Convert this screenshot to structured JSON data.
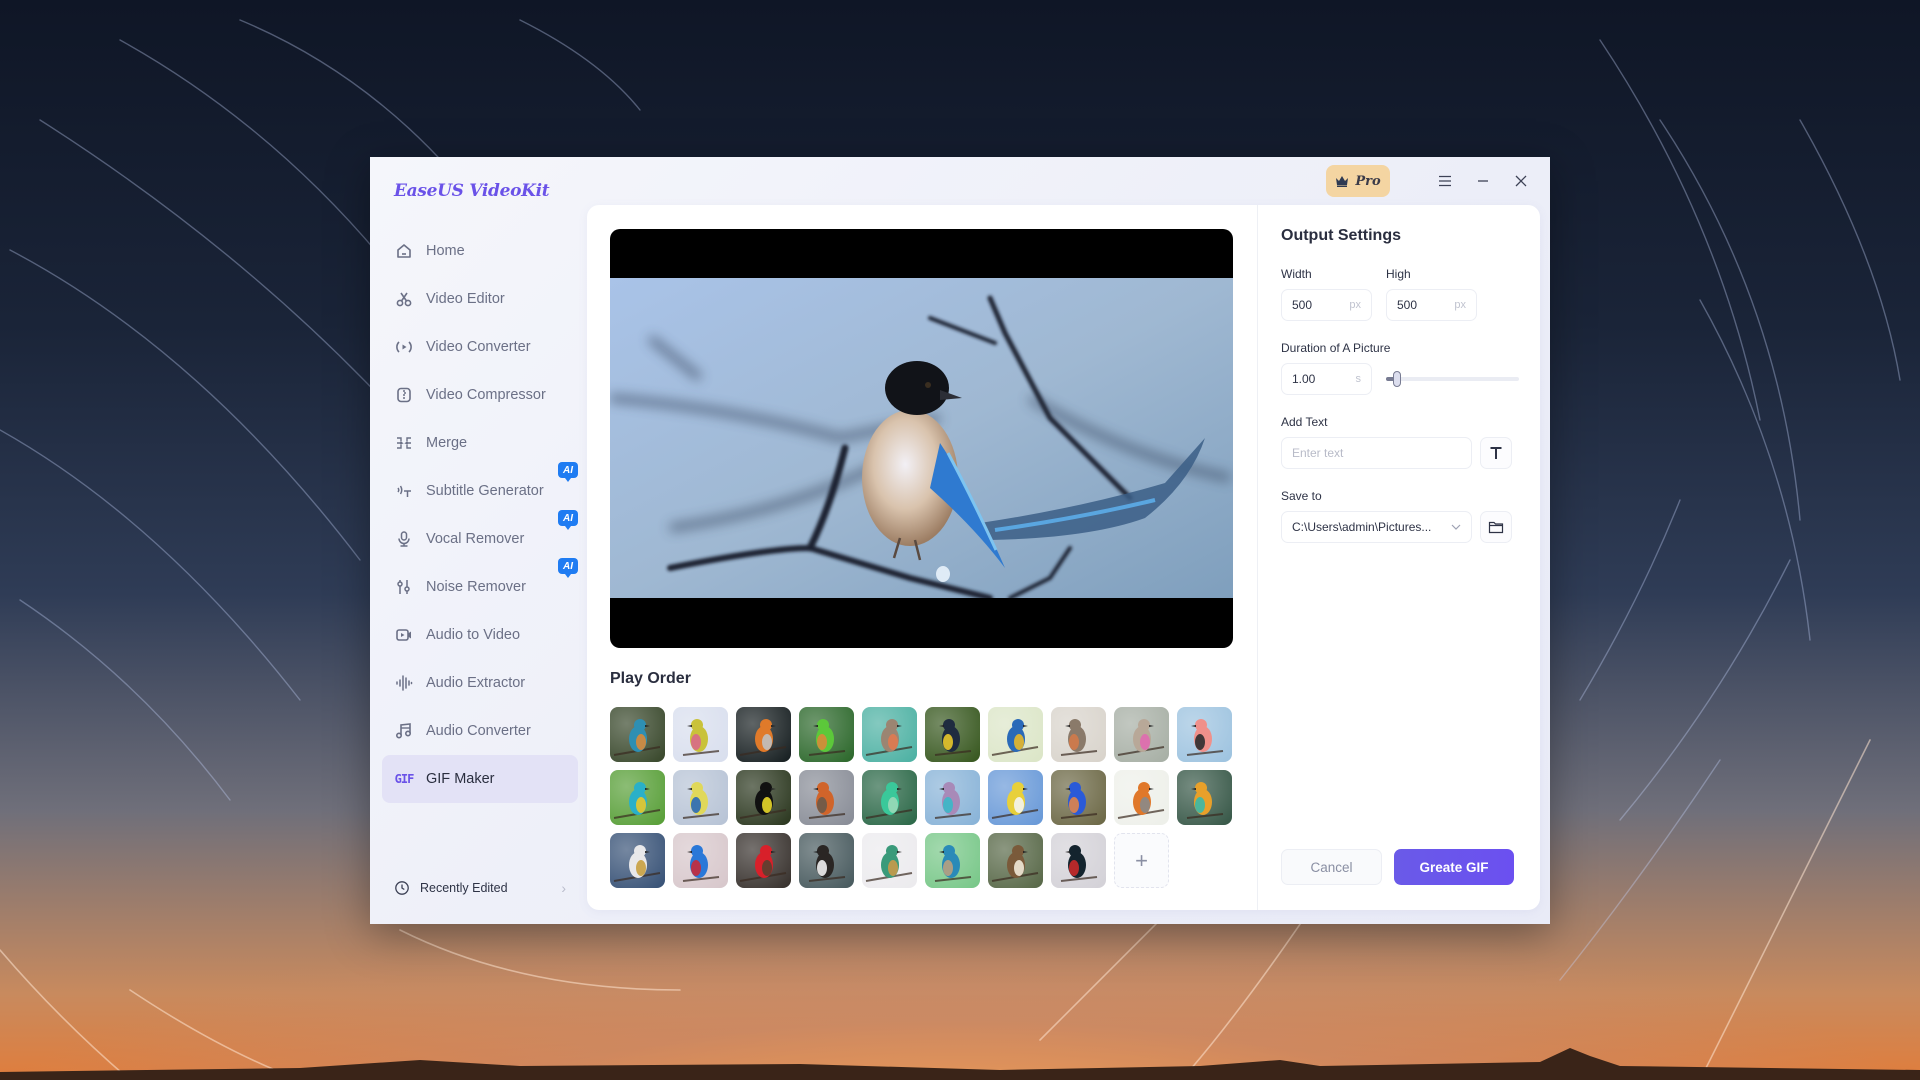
{
  "app": {
    "title": "EaseUS VideoKit",
    "brand_color": "#6a52e8",
    "pro_label": "Pro"
  },
  "window_controls": {
    "menu": "menu-icon",
    "minimize": "minimize-icon",
    "close": "close-icon"
  },
  "sidebar": {
    "items": [
      {
        "label": "Home",
        "icon": "home-icon",
        "ai": false,
        "active": false
      },
      {
        "label": "Video Editor",
        "icon": "scissors-icon",
        "ai": false,
        "active": false
      },
      {
        "label": "Video Converter",
        "icon": "convert-icon",
        "ai": false,
        "active": false
      },
      {
        "label": "Video Compressor",
        "icon": "compress-icon",
        "ai": false,
        "active": false
      },
      {
        "label": "Merge",
        "icon": "merge-icon",
        "ai": false,
        "active": false
      },
      {
        "label": "Subtitle Generator",
        "icon": "subtitle-icon",
        "ai": true,
        "active": false
      },
      {
        "label": "Vocal Remover",
        "icon": "microphone-icon",
        "ai": true,
        "active": false
      },
      {
        "label": "Noise Remover",
        "icon": "equalizer-icon",
        "ai": true,
        "active": false
      },
      {
        "label": "Audio to Video",
        "icon": "video-camera-icon",
        "ai": false,
        "active": false
      },
      {
        "label": "Audio Extractor",
        "icon": "waveform-icon",
        "ai": false,
        "active": false
      },
      {
        "label": "Audio Converter",
        "icon": "music-note-icon",
        "ai": false,
        "active": false
      },
      {
        "label": "GIF Maker",
        "icon": "gif-icon",
        "ai": false,
        "active": true
      }
    ],
    "ai_badge": "AI",
    "gif_glyph": "GIF",
    "recently_edited": "Recently Edited"
  },
  "preview": {
    "subject": "Azure-winged magpie perched on a branch"
  },
  "play_order": {
    "title": "Play Order",
    "add_label": "+",
    "images": [
      {
        "name": "kingfisher",
        "bg": "#3b4a2e",
        "c1": "#2e8fb3",
        "c2": "#d88a3a"
      },
      {
        "name": "white-eye",
        "bg": "#d9dfee",
        "c1": "#c9c23a",
        "c2": "#d86a8a"
      },
      {
        "name": "sun-conure",
        "bg": "#1a2224",
        "c1": "#e07a2a",
        "c2": "#c0c0c0"
      },
      {
        "name": "green-parakeet",
        "bg": "#2f6a2e",
        "c1": "#5cc83a",
        "c2": "#d88a3a"
      },
      {
        "name": "robin",
        "bg": "#4fb2a4",
        "c1": "#9b8572",
        "c2": "#e07a50"
      },
      {
        "name": "toucan",
        "bg": "#3a5a22",
        "c1": "#1f2c40",
        "c2": "#e8c82a"
      },
      {
        "name": "macaw",
        "bg": "#dce6c8",
        "c1": "#2a6ab8",
        "c2": "#e8b82a"
      },
      {
        "name": "robin-singing",
        "bg": "#d9d4cc",
        "c1": "#8a7a6a",
        "c2": "#d07a4a"
      },
      {
        "name": "hummingbird",
        "bg": "#a8b0a6",
        "c1": "#b8a898",
        "c2": "#e06ab0"
      },
      {
        "name": "flamingo",
        "bg": "#9fc4e0",
        "c1": "#f0908a",
        "c2": "#2e2e2e"
      },
      {
        "name": "bee-eater",
        "bg": "#5aa03a",
        "c1": "#2ab0c8",
        "c2": "#e8c82a"
      },
      {
        "name": "blue-tit",
        "bg": "#b8c4d6",
        "c1": "#e0d85a",
        "c2": "#2a6ab8"
      },
      {
        "name": "keel-billed-toucan",
        "bg": "#2e3a22",
        "c1": "#111111",
        "c2": "#e8d82a"
      },
      {
        "name": "european-robin",
        "bg": "#8a8e98",
        "c1": "#d0642a",
        "c2": "#6a5a4a"
      },
      {
        "name": "green-hummingbird",
        "bg": "#2e6a4a",
        "c1": "#3ac89a",
        "c2": "#9ad8b8"
      },
      {
        "name": "lilac-roller",
        "bg": "#8ab4d8",
        "c1": "#a88ab8",
        "c2": "#3ab8c8"
      },
      {
        "name": "yellow-warbler",
        "bg": "#6a9ad8",
        "c1": "#e8d03a",
        "c2": "#f4f4f0"
      },
      {
        "name": "malachite-kingfisher",
        "bg": "#6e6a48",
        "c1": "#2a5ad8",
        "c2": "#e0844a"
      },
      {
        "name": "robin-white",
        "bg": "#eef0ea",
        "c1": "#e0782a",
        "c2": "#8a8a8a"
      },
      {
        "name": "rainbow-bee-eater",
        "bg": "#3a5a4a",
        "c1": "#e8a02a",
        "c2": "#3ab8a8"
      },
      {
        "name": "tern",
        "bg": "#3a5478",
        "c1": "#e8e8ea",
        "c2": "#c8a040"
      },
      {
        "name": "bluebird",
        "bg": "#d8c8cc",
        "c1": "#2a78d8",
        "c2": "#c82a3a"
      },
      {
        "name": "cardinal",
        "bg": "#3a3430",
        "c1": "#d8202a",
        "c2": "#5a4030"
      },
      {
        "name": "eagle",
        "bg": "#4a5c60",
        "c1": "#2a2624",
        "c2": "#f0f0f0"
      },
      {
        "name": "hummingbird-flight",
        "bg": "#ecebee",
        "c1": "#3a9a7a",
        "c2": "#c89a4a"
      },
      {
        "name": "drongo",
        "bg": "#7ac88a",
        "c1": "#2a8ab8",
        "c2": "#b8a080"
      },
      {
        "name": "owl",
        "bg": "#5a6a4a",
        "c1": "#7a5a3a",
        "c2": "#f0e8d8"
      },
      {
        "name": "grouse",
        "bg": "#d4d2d8",
        "c1": "#14242e",
        "c2": "#c82a2a"
      }
    ]
  },
  "settings": {
    "title": "Output Settings",
    "width_label": "Width",
    "width_value": "500",
    "height_label": "High",
    "height_value": "500",
    "unit_px": "px",
    "duration_label": "Duration of A Picture",
    "duration_value": "1.00",
    "unit_s": "s",
    "duration_slider_fraction": 0.08,
    "add_text_label": "Add Text",
    "add_text_placeholder": "Enter text",
    "text_style_icon": "text-T-icon",
    "save_to_label": "Save to",
    "save_to_value": "C:\\Users\\admin\\Pictures...",
    "folder_icon": "folder-icon",
    "cancel_label": "Cancel",
    "create_label": "Greate GIF"
  }
}
